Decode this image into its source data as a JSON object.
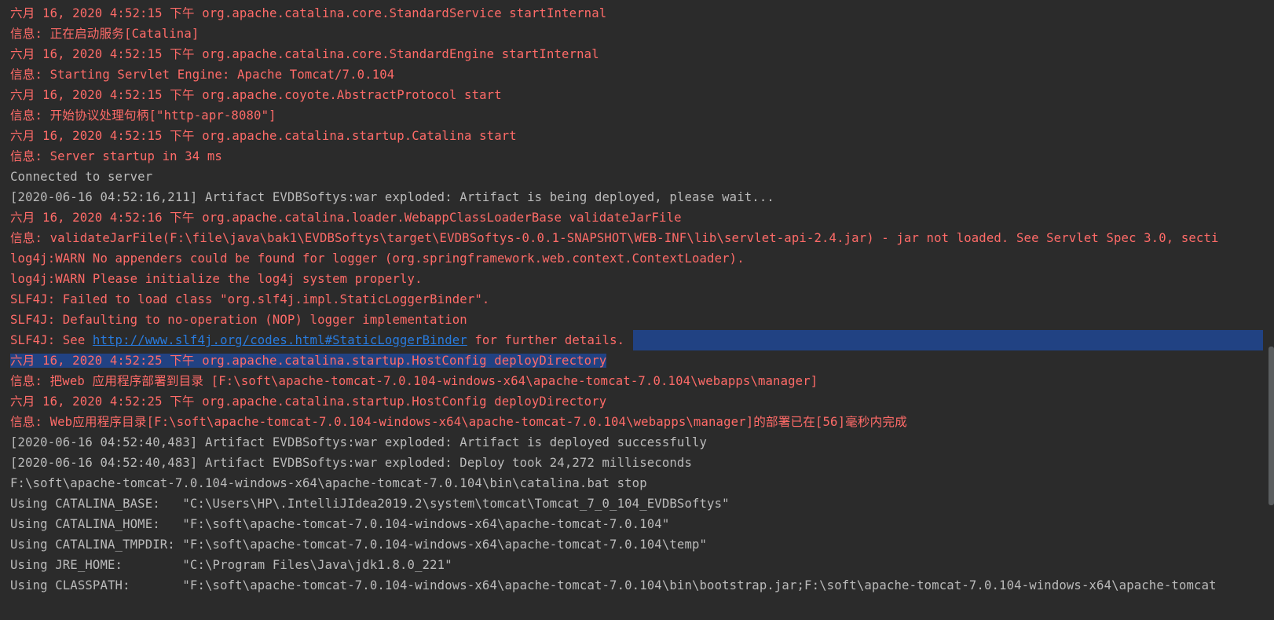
{
  "console": {
    "lines": [
      {
        "kind": "stderr",
        "text": "六月 16, 2020 4:52:15 下午 org.apache.catalina.core.StandardService startInternal"
      },
      {
        "kind": "stderr",
        "text": "信息: 正在启动服务[Catalina]"
      },
      {
        "kind": "stderr",
        "text": "六月 16, 2020 4:52:15 下午 org.apache.catalina.core.StandardEngine startInternal"
      },
      {
        "kind": "stderr",
        "text": "信息: Starting Servlet Engine: Apache Tomcat/7.0.104"
      },
      {
        "kind": "stderr",
        "text": "六月 16, 2020 4:52:15 下午 org.apache.coyote.AbstractProtocol start"
      },
      {
        "kind": "stderr",
        "text": "信息: 开始协议处理句柄[\"http-apr-8080\"]"
      },
      {
        "kind": "stderr",
        "text": "六月 16, 2020 4:52:15 下午 org.apache.catalina.startup.Catalina start"
      },
      {
        "kind": "stderr",
        "text": "信息: Server startup in 34 ms"
      },
      {
        "kind": "stdout",
        "text": "Connected to server"
      },
      {
        "kind": "stdout",
        "text": "[2020-06-16 04:52:16,211] Artifact EVDBSoftys:war exploded: Artifact is being deployed, please wait..."
      },
      {
        "kind": "stderr",
        "text": "六月 16, 2020 4:52:16 下午 org.apache.catalina.loader.WebappClassLoaderBase validateJarFile"
      },
      {
        "kind": "stderr",
        "text": "信息: validateJarFile(F:\\file\\java\\bak1\\EVDBSoftys\\target\\EVDBSoftys-0.0.1-SNAPSHOT\\WEB-INF\\lib\\servlet-api-2.4.jar) - jar not loaded. See Servlet Spec 3.0, secti"
      },
      {
        "kind": "stderr",
        "text": "log4j:WARN No appenders could be found for logger (org.springframework.web.context.ContextLoader)."
      },
      {
        "kind": "stderr",
        "text": "log4j:WARN Please initialize the log4j system properly."
      },
      {
        "kind": "stderr",
        "text": "SLF4J: Failed to load class \"org.slf4j.impl.StaticLoggerBinder\"."
      },
      {
        "kind": "stderr",
        "text": "SLF4J: Defaulting to no-operation (NOP) logger implementation"
      },
      {
        "kind": "stderr",
        "pre": "SLF4J: See ",
        "link": "http://www.slf4j.org/codes.html#StaticLoggerBinder",
        "post": " for further details."
      },
      {
        "kind": "stderr",
        "text": "六月 16, 2020 4:52:25 下午 org.apache.catalina.startup.HostConfig deployDirectory",
        "selected": true
      },
      {
        "kind": "stderr",
        "text": "信息: 把web 应用程序部署到目录 [F:\\soft\\apache-tomcat-7.0.104-windows-x64\\apache-tomcat-7.0.104\\webapps\\manager]"
      },
      {
        "kind": "stderr",
        "text": "六月 16, 2020 4:52:25 下午 org.apache.catalina.startup.HostConfig deployDirectory"
      },
      {
        "kind": "stderr",
        "text": "信息: Web应用程序目录[F:\\soft\\apache-tomcat-7.0.104-windows-x64\\apache-tomcat-7.0.104\\webapps\\manager]的部署已在[56]毫秒内完成"
      },
      {
        "kind": "stdout",
        "text": "[2020-06-16 04:52:40,483] Artifact EVDBSoftys:war exploded: Artifact is deployed successfully"
      },
      {
        "kind": "stdout",
        "text": "[2020-06-16 04:52:40,483] Artifact EVDBSoftys:war exploded: Deploy took 24,272 milliseconds"
      },
      {
        "kind": "stdout",
        "text": "F:\\soft\\apache-tomcat-7.0.104-windows-x64\\apache-tomcat-7.0.104\\bin\\catalina.bat stop"
      },
      {
        "kind": "stdout",
        "text": "Using CATALINA_BASE:   \"C:\\Users\\HP\\.IntelliJIdea2019.2\\system\\tomcat\\Tomcat_7_0_104_EVDBSoftys\""
      },
      {
        "kind": "stdout",
        "text": "Using CATALINA_HOME:   \"F:\\soft\\apache-tomcat-7.0.104-windows-x64\\apache-tomcat-7.0.104\""
      },
      {
        "kind": "stdout",
        "text": "Using CATALINA_TMPDIR: \"F:\\soft\\apache-tomcat-7.0.104-windows-x64\\apache-tomcat-7.0.104\\temp\""
      },
      {
        "kind": "stdout",
        "text": "Using JRE_HOME:        \"C:\\Program Files\\Java\\jdk1.8.0_221\""
      },
      {
        "kind": "stdout",
        "text": "Using CLASSPATH:       \"F:\\soft\\apache-tomcat-7.0.104-windows-x64\\apache-tomcat-7.0.104\\bin\\bootstrap.jar;F:\\soft\\apache-tomcat-7.0.104-windows-x64\\apache-tomcat"
      }
    ]
  },
  "colors": {
    "background": "#2b2b2b",
    "stderr": "#ff6b68",
    "stdout": "#bbbbbb",
    "link": "#287bde",
    "selection": "#214283"
  }
}
